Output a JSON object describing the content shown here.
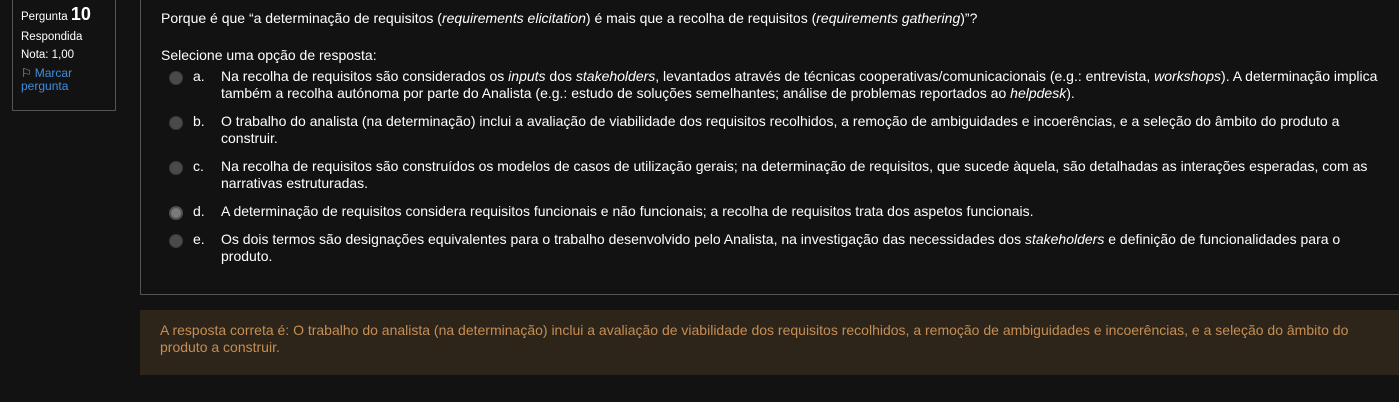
{
  "info": {
    "question_label": "Pergunta",
    "question_number": "10",
    "status": "Respondida",
    "grade": "Nota: 1,00",
    "flag_label": "Marcar pergunta",
    "flag_icon": "flag-icon"
  },
  "question": [
    {
      "t": "Porque é que “a determinação de requisitos (",
      "i": false
    },
    {
      "t": "requirements elicitation",
      "i": true
    },
    {
      "t": ") é mais que a recolha de requisitos (",
      "i": false
    },
    {
      "t": "requirements gathering",
      "i": true
    },
    {
      "t": ")”?",
      "i": false
    }
  ],
  "prompt": "Selecione uma opção de resposta:",
  "selected": "d",
  "answers": [
    {
      "letter": "a.",
      "segments": [
        {
          "t": "Na recolha de requisitos são considerados os ",
          "i": false
        },
        {
          "t": "inputs",
          "i": true
        },
        {
          "t": " dos ",
          "i": false
        },
        {
          "t": "stakeholders",
          "i": true
        },
        {
          "t": ", levantados através de técnicas cooperativas/comunicacionais (e.g.: entrevista, ",
          "i": false
        },
        {
          "t": "workshops",
          "i": true
        },
        {
          "t": "). A determinação implica também a recolha autónoma por parte do Analista (e.g.: estudo de soluções semelhantes; análise de problemas reportados ao ",
          "i": false
        },
        {
          "t": "helpdesk",
          "i": true
        },
        {
          "t": ").",
          "i": false
        }
      ]
    },
    {
      "letter": "b.",
      "segments": [
        {
          "t": "O trabalho do analista (na determinação) inclui a avaliação de viabilidade dos requisitos recolhidos, a remoção de ambiguidades e incoerências, e a seleção do âmbito do produto a construir.",
          "i": false
        }
      ]
    },
    {
      "letter": "c.",
      "segments": [
        {
          "t": "Na recolha de requisitos são construídos os modelos de casos de utilização gerais; na determinação de requisitos, que sucede àquela, são detalhadas as interações esperadas, com as narrativas estruturadas.",
          "i": false
        }
      ]
    },
    {
      "letter": "d.",
      "segments": [
        {
          "t": "A determinação de requisitos considera requisitos funcionais e não funcionais; a recolha de requisitos trata dos aspetos funcionais.",
          "i": false
        }
      ]
    },
    {
      "letter": "e.",
      "segments": [
        {
          "t": "Os dois termos são designações equivalentes para o trabalho desenvolvido pelo Analista, na investigação das necessidades dos ",
          "i": false
        },
        {
          "t": "stakeholders",
          "i": true
        },
        {
          "t": " e definição de funcionalidades para o produto.",
          "i": false
        }
      ]
    }
  ],
  "feedback": "A resposta correta é: O trabalho do analista (na determinação) inclui a avaliação de viabilidade dos requisitos recolhidos, a remoção de ambiguidades e incoerências, e a seleção do âmbito do produto a construir."
}
